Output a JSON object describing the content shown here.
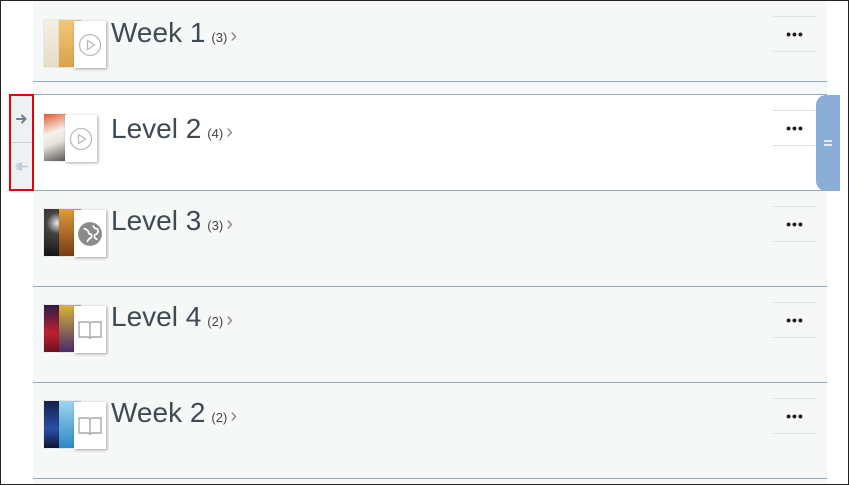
{
  "colors": {
    "accent": "#8aaed6",
    "highlight": "#e3000f"
  },
  "side_tools": [
    {
      "icon": "arrow-right-icon"
    },
    {
      "icon": "arrow-left-icon"
    }
  ],
  "rows": [
    {
      "title": "Week 1",
      "count": "(3)",
      "chevron": "›",
      "type_icon": "play-icon",
      "more": "•••"
    },
    {
      "title": "Level 2",
      "count": "(4)",
      "chevron": "›",
      "type_icon": "play-icon",
      "more": "•••"
    },
    {
      "title": "Level 3",
      "count": "(3)",
      "chevron": "›",
      "type_icon": "globe-icon",
      "more": "•••"
    },
    {
      "title": "Level 4",
      "count": "(2)",
      "chevron": "›",
      "type_icon": "book-icon",
      "more": "•••"
    },
    {
      "title": "Week 2",
      "count": "(2)",
      "chevron": "›",
      "type_icon": "book-icon",
      "more": "•••"
    }
  ],
  "drag_handle_icon": "drag-handle-icon"
}
